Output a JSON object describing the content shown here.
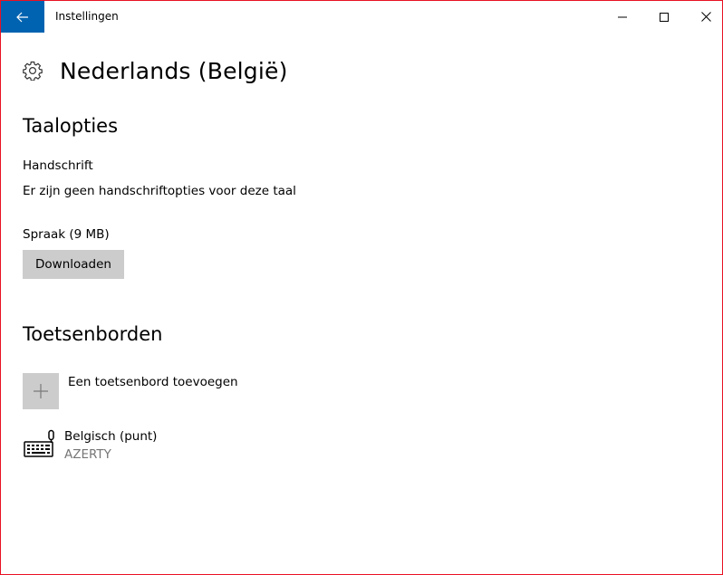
{
  "window": {
    "title": "Instellingen",
    "accent_color": "#0063b1",
    "border_color": "#e81123"
  },
  "icons": {
    "back": "back-arrow-icon",
    "minimize": "minimize-icon",
    "maximize": "maximize-icon",
    "close": "close-icon",
    "settings": "gear-icon",
    "add": "plus-icon",
    "keyboard": "keyboard-icon"
  },
  "header": {
    "title": "Nederlands (België)"
  },
  "language_options": {
    "heading": "Taalopties",
    "handwriting_label": "Handschrift",
    "handwriting_status": "Er zijn geen handschriftopties voor deze taal",
    "speech_label": "Spraak (9 MB)",
    "download_button": "Downloaden"
  },
  "keyboards": {
    "heading": "Toetsenborden",
    "add_label": "Een toetsenbord toevoegen",
    "items": [
      {
        "name": "Belgisch (punt)",
        "layout": "AZERTY"
      }
    ]
  }
}
